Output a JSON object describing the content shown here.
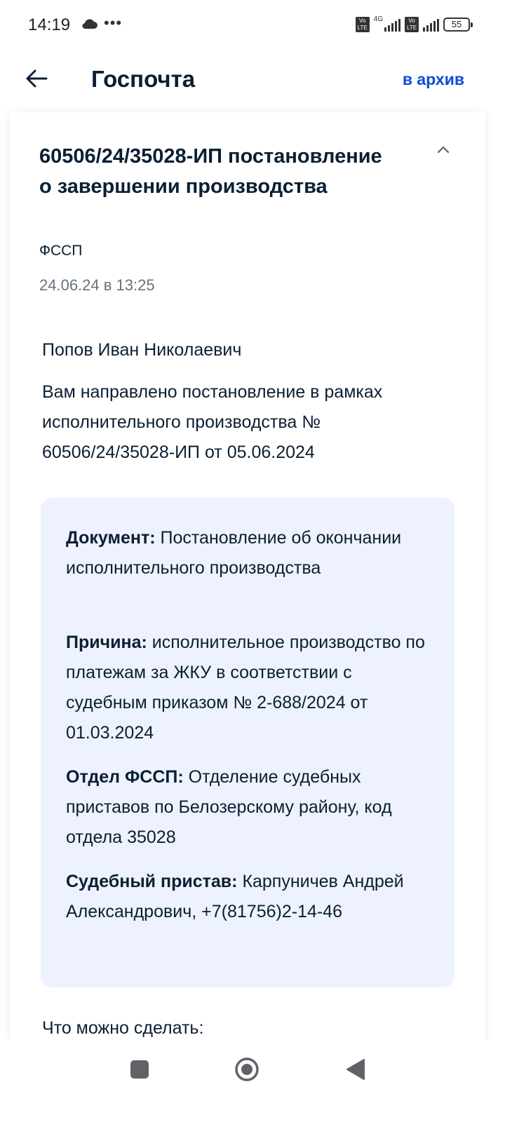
{
  "status_bar": {
    "time": "14:19",
    "icons": [
      "cloud-icon",
      "more-dots-icon",
      "volte-icon",
      "signal-icon",
      "battery-icon"
    ],
    "network": "4G",
    "volte_label": "Vo LTE",
    "battery": "55"
  },
  "header": {
    "title": "Госпочта",
    "archive_label": "в архив",
    "accent_color": "#0d4cd3"
  },
  "message": {
    "title": "60506/24/35028-ИП постановление о завершении производства",
    "sender": "ФССП",
    "date": "24.06.24 в 13:25",
    "recipient": "Попов Иван Николаевич",
    "intro": "Вам направлено постановление в рамках исполнительного производства № 60506/24/35028-ИП от 05.06.2024",
    "details": [
      {
        "label": "Документ:",
        "value": "Постановление об окончании исполнительного производства"
      },
      {
        "label": "Причина:",
        "value": "исполнительное производство по платежам за ЖКУ в соответствии с судебным приказом № 2-688/2024 от 01.03.2024"
      },
      {
        "label": "Отдел ФССП:",
        "value": "Отделение судебных приставов по Белозерскому району, код отдела 35028"
      },
      {
        "label": "Судебный пристав:",
        "value": "Карпуничев Андрей Александрович, +7(81756)2-14-46"
      }
    ],
    "actions_heading": "Что можно сделать:"
  },
  "nav": {
    "icons": [
      "recent-apps-icon",
      "home-icon",
      "back-icon"
    ]
  }
}
